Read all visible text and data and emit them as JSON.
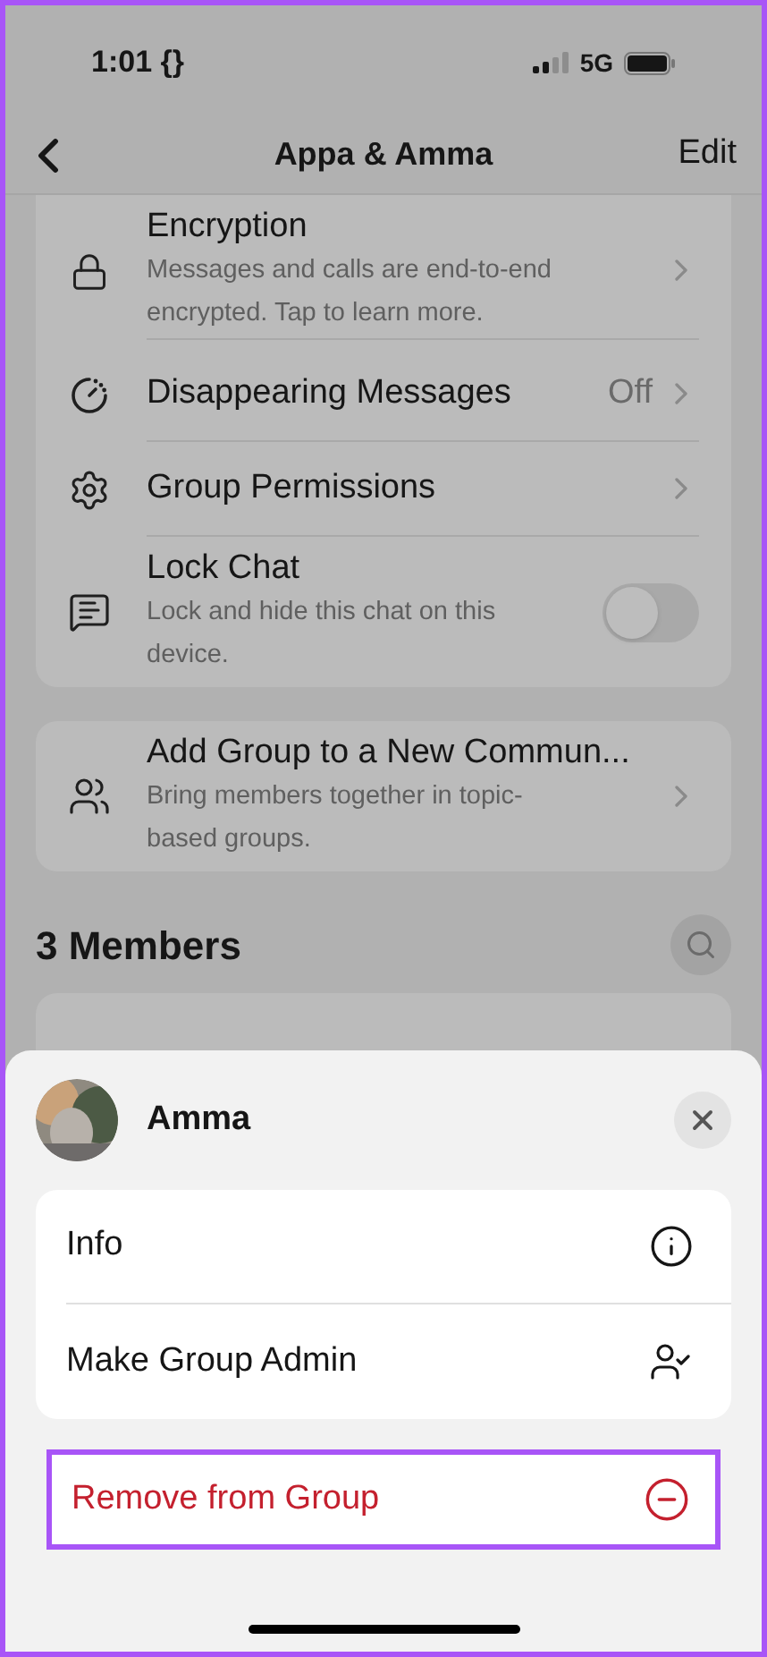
{
  "status_bar": {
    "time": "1:01 {}",
    "network": "5G"
  },
  "nav": {
    "title": "Appa & Amma",
    "action": "Edit"
  },
  "settings": [
    {
      "kind": "link",
      "title": "Encryption",
      "subtitle": "Messages and calls are end-to-end encrypted. Tap to learn more."
    },
    {
      "kind": "link",
      "title": "Disappearing Messages",
      "value": "Off"
    },
    {
      "kind": "link",
      "title": "Group Permissions"
    },
    {
      "kind": "toggle",
      "title": "Lock Chat",
      "subtitle": "Lock and hide this chat on this device.",
      "on": false
    }
  ],
  "community": {
    "title": "Add Group to a New Commun...",
    "subtitle": "Bring members together in topic-based groups."
  },
  "members": {
    "title": "3 Members"
  },
  "sheet": {
    "name": "Amma",
    "actions": [
      {
        "kind": "info",
        "label": "Info"
      },
      {
        "kind": "admin",
        "label": "Make Group Admin"
      }
    ],
    "danger_action": {
      "label": "Remove from Group",
      "highlighted": true
    }
  }
}
